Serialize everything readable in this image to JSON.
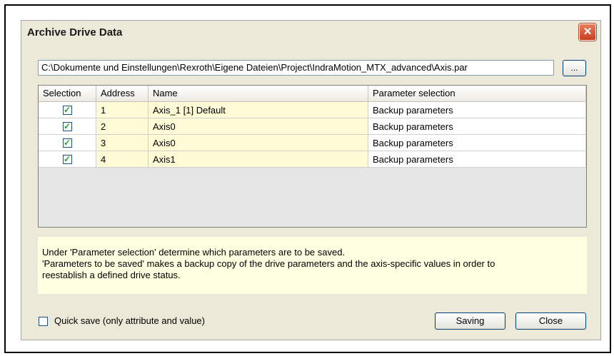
{
  "dialog": {
    "title": "Archive Drive Data",
    "close_glyph": "✕",
    "path_value": "C:\\Dokumente und Einstellungen\\Rexroth\\Eigene Dateien\\Project\\IndraMotion_MTX_advanced\\Axis.par",
    "browse_label": "...",
    "columns": [
      "Selection",
      "Address",
      "Name",
      "Parameter selection"
    ],
    "rows": [
      {
        "checked": true,
        "address": "1",
        "name": "Axis_1 [1] Default",
        "param": "Backup parameters"
      },
      {
        "checked": true,
        "address": "2",
        "name": "Axis0",
        "param": "Backup parameters"
      },
      {
        "checked": true,
        "address": "3",
        "name": "Axis0",
        "param": "Backup parameters"
      },
      {
        "checked": true,
        "address": "4",
        "name": "Axis1",
        "param": "Backup parameters"
      }
    ],
    "check_glyph": "✓",
    "info_line1": "Under 'Parameter selection' determine which parameters are to be saved.",
    "info_line2": "'Parameters to be saved' makes a backup copy of the drive parameters and the axis-specific values in order to",
    "info_line3": "reestablish a defined drive status.",
    "quick_save_label": "Quick save (only attribute and value)",
    "quick_save_checked": false,
    "saving_label": "Saving",
    "close_label": "Close"
  },
  "colors": {
    "dialog_bg": "#ece9d8",
    "editable_cell_bg": "#fffbd6",
    "info_bg": "#ffffe1",
    "checkmark": "#21a121",
    "close_button": "#c8401e"
  }
}
